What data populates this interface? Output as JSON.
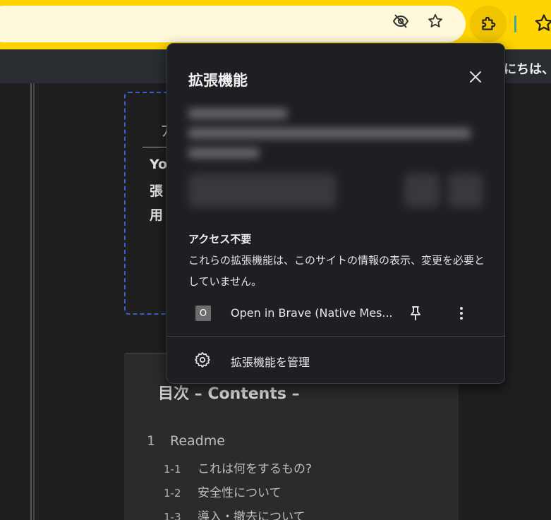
{
  "browser": {
    "greeting_partial": "にちは、"
  },
  "extensions_popup": {
    "title": "拡張機能",
    "no_access_section": {
      "heading": "アクセス不要",
      "description": "これらの拡張機能は、このサイトの情報の表示、変更を必要としていません。"
    },
    "extensions": [
      {
        "icon_letter": "O",
        "name": "Open in Brave (Native Mes..."
      }
    ],
    "manage_label": "拡張機能を管理"
  },
  "background_page": {
    "partial_char": "ﾌﾞ",
    "partial_lines": [
      "Yo",
      "張",
      "用"
    ],
    "toc": {
      "title": "目次 – Contents –",
      "items": [
        {
          "num": "1",
          "label": "Readme"
        },
        {
          "num": "1-1",
          "label": "これは何をするもの?"
        },
        {
          "num": "1-2",
          "label": "安全性について"
        },
        {
          "num": "1-3",
          "label": "導入・撤去について"
        }
      ]
    }
  }
}
